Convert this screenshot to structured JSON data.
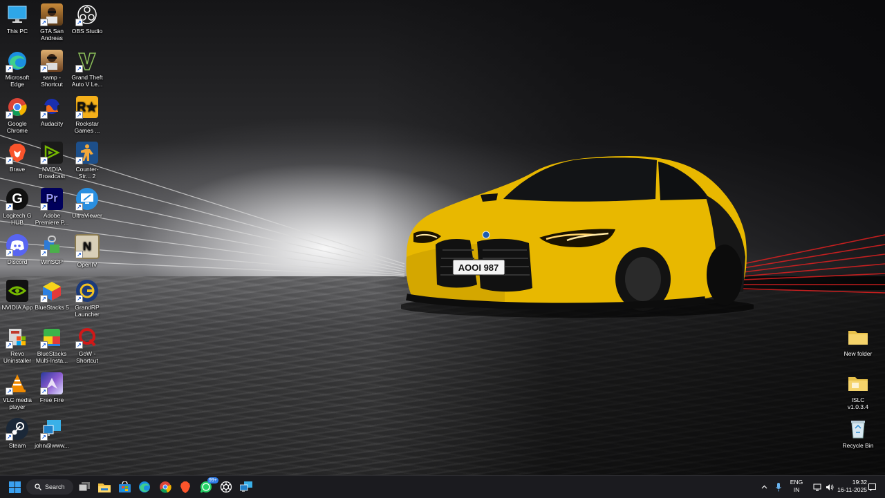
{
  "desktop": {
    "icons": [
      {
        "label": "This PC",
        "icon": "monitor-icon"
      },
      {
        "label": "GTA San Andreas",
        "icon": "gta-sa-icon"
      },
      {
        "label": "OBS Studio",
        "icon": "obs-icon"
      },
      {
        "label": "Microsoft Edge",
        "icon": "edge-icon"
      },
      {
        "label": "samp - Shortcut",
        "icon": "samp-icon"
      },
      {
        "label": "Grand Theft Auto V Le...",
        "icon": "gta-v-icon"
      },
      {
        "label": "Google Chrome",
        "icon": "chrome-icon"
      },
      {
        "label": "Audacity",
        "icon": "audacity-icon"
      },
      {
        "label": "Rockstar Games ...",
        "icon": "rockstar-icon"
      },
      {
        "label": "Brave",
        "icon": "brave-icon"
      },
      {
        "label": "NVIDIA Broadcast",
        "icon": "nvidia-broadcast-icon"
      },
      {
        "label": "Counter-Str... 2",
        "icon": "counter-strike-icon"
      },
      {
        "label": "Logitech G HUB",
        "icon": "logitech-icon"
      },
      {
        "label": "Adobe Premiere P...",
        "icon": "premiere-icon"
      },
      {
        "label": "UltraViewer",
        "icon": "ultraviewer-icon"
      },
      {
        "label": "Discord",
        "icon": "discord-icon"
      },
      {
        "label": "WinSCP",
        "icon": "winscp-icon"
      },
      {
        "label": "OpenIV",
        "icon": "openiv-icon"
      },
      {
        "label": "NVIDIA App",
        "icon": "nvidia-icon"
      },
      {
        "label": "BlueStacks 5",
        "icon": "bluestacks-icon"
      },
      {
        "label": "GrandRP Launcher",
        "icon": "grandrp-icon"
      },
      {
        "label": "Revo Uninstaller",
        "icon": "revo-icon"
      },
      {
        "label": "BlueStacks Multi-Insta...",
        "icon": "bluestacks-multi-icon"
      },
      {
        "label": "GoW - Shortcut",
        "icon": "gow-icon"
      },
      {
        "label": "VLC media player",
        "icon": "vlc-icon"
      },
      {
        "label": "Free Fire",
        "icon": "free-fire-icon"
      },
      {
        "label": "Steam",
        "icon": "steam-icon"
      },
      {
        "label": "john@www...",
        "icon": "remote-session-icon"
      }
    ],
    "right_icons": [
      {
        "label": "New folder",
        "icon": "folder-icon"
      },
      {
        "label": "ISLC v1.0.3.4",
        "icon": "folder-icon"
      },
      {
        "label": "Recycle Bin",
        "icon": "recycle-bin-icon"
      }
    ],
    "license_plate": "AOOI 987"
  },
  "taskbar": {
    "search_label": "Search",
    "whatsapp_badge": "99+",
    "pinned": [
      "start-icon",
      "search-icon",
      "task-view-icon",
      "file-explorer-icon",
      "store-icon",
      "edge-icon",
      "chrome-icon",
      "brave-icon",
      "whatsapp-icon",
      "chatgpt-icon",
      "network-app-icon"
    ],
    "tray": {
      "lang_line1": "ENG",
      "lang_line2": "IN",
      "time": "19:32",
      "date": "16-11-2025"
    }
  },
  "colors": {
    "taskbar_bg": "#1b1b1f",
    "car_yellow": "#f2c400",
    "accent": "#2f7de8"
  }
}
